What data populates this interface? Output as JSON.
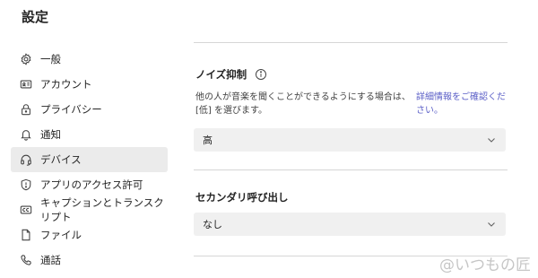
{
  "page": {
    "title": "設定"
  },
  "sidebar": {
    "items": [
      {
        "label": "一般",
        "icon": "gear-icon"
      },
      {
        "label": "アカウント",
        "icon": "id-card-icon"
      },
      {
        "label": "プライバシー",
        "icon": "lock-icon"
      },
      {
        "label": "通知",
        "icon": "bell-icon"
      },
      {
        "label": "デバイス",
        "icon": "headset-icon",
        "active": true
      },
      {
        "label": "アプリのアクセス許可",
        "icon": "shield-icon"
      },
      {
        "label": "キャプションとトランスクリプト",
        "icon": "cc-icon"
      },
      {
        "label": "ファイル",
        "icon": "file-icon"
      },
      {
        "label": "通話",
        "icon": "phone-icon"
      }
    ]
  },
  "noise": {
    "heading": "ノイズ抑制",
    "description": "他の人が音楽を聞くことができるようにする場合は、[低] を選びます。",
    "link": "詳細情報をご確認ください。",
    "selected": "高"
  },
  "secondary_ring": {
    "heading": "セカンダリ呼び出し",
    "selected": "なし"
  },
  "watermark": "@いつもの匠",
  "colors": {
    "accent": "#5b5fc7",
    "active_bg": "#ebebeb",
    "dropdown_bg": "#f0f0f0"
  }
}
